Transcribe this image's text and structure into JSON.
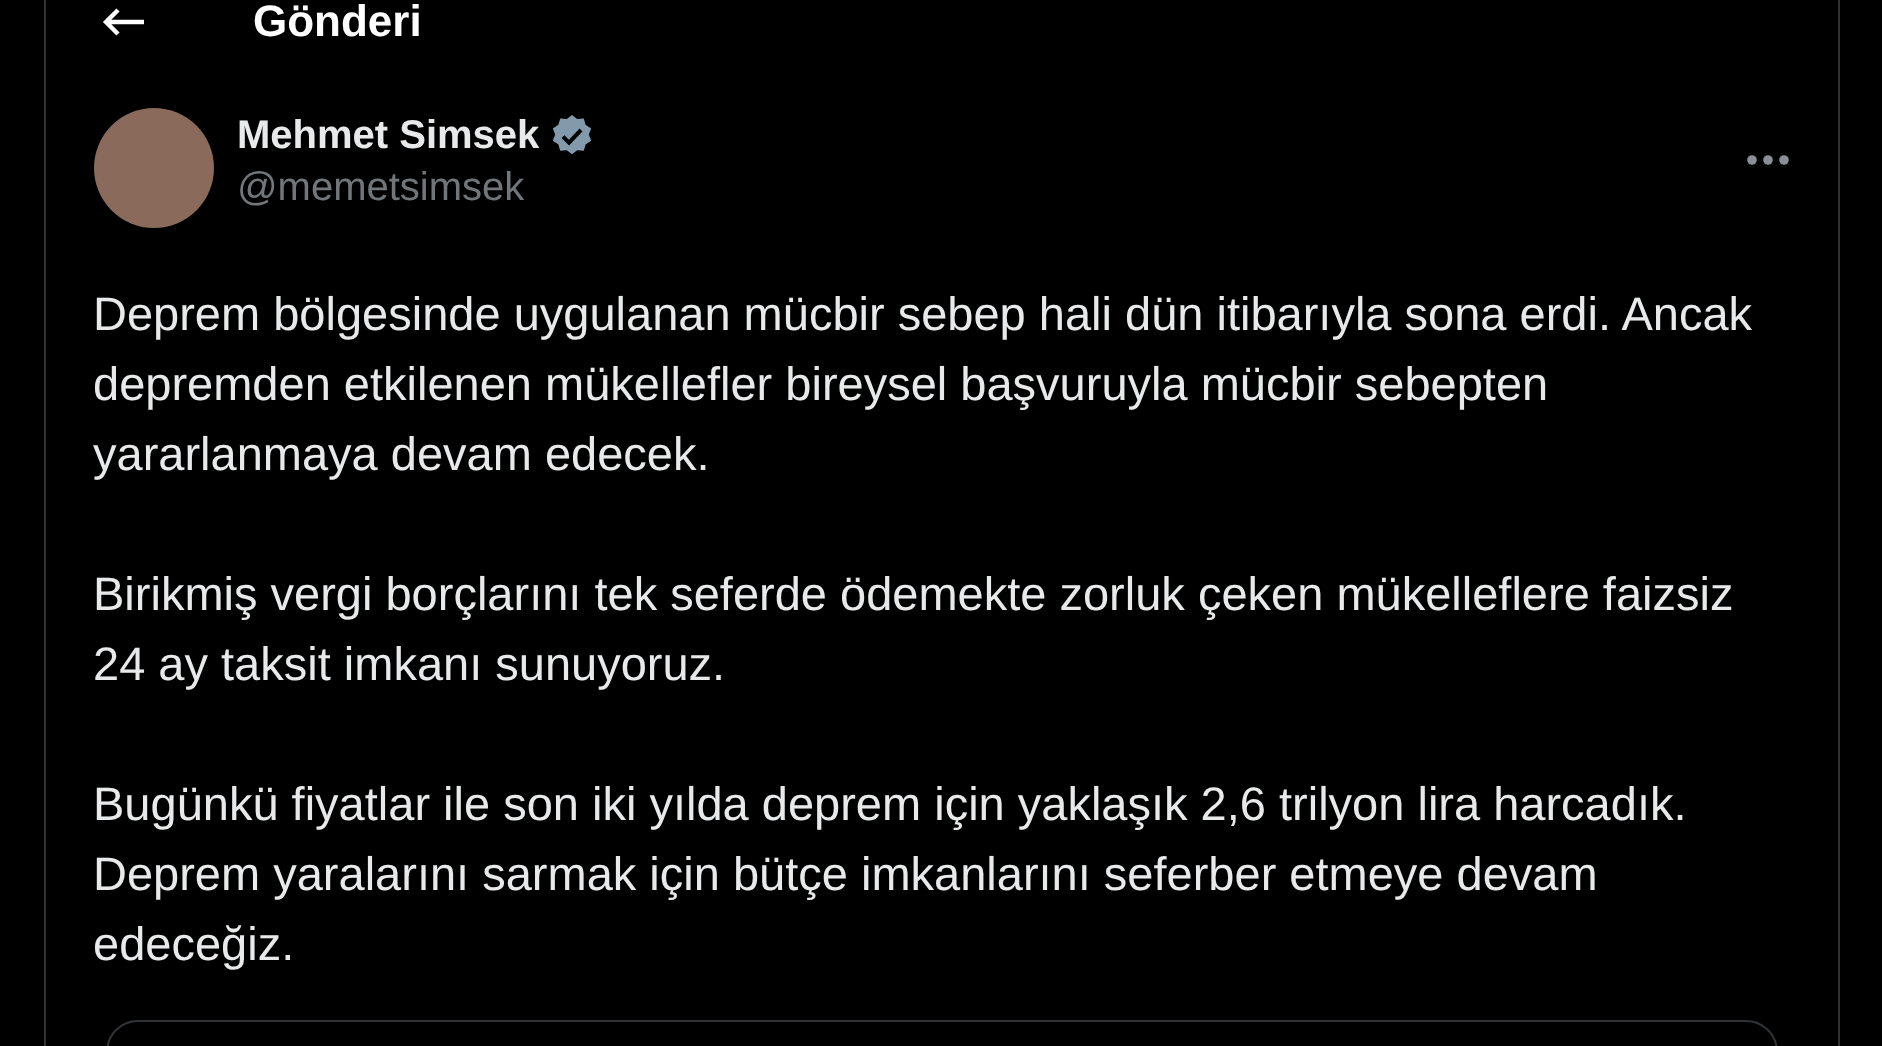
{
  "header": {
    "title": "Gönderi"
  },
  "author": {
    "name": "Mehmet Simsek",
    "handle": "@memetsimsek",
    "verified": true
  },
  "paragraphs": [
    "Deprem bölgesinde uygulanan mücbir sebep hali dün itibarıyla sona erdi. Ancak depremden etkilenen mükellefler bireysel başvuruyla mücbir sebepten yararlanmaya devam edecek.",
    "Birikmiş vergi borçlarını tek seferde ödemekte zorluk çeken mükelleflere faizsiz 24 ay taksit imkanı sunuyoruz.",
    "Bugünkü fiyatlar ile son iki yılda deprem için yaklaşık 2,6 trilyon lira harcadık. Deprem yaralarını sarmak için bütçe imkanlarını seferber etmeye devam edeceğiz."
  ]
}
